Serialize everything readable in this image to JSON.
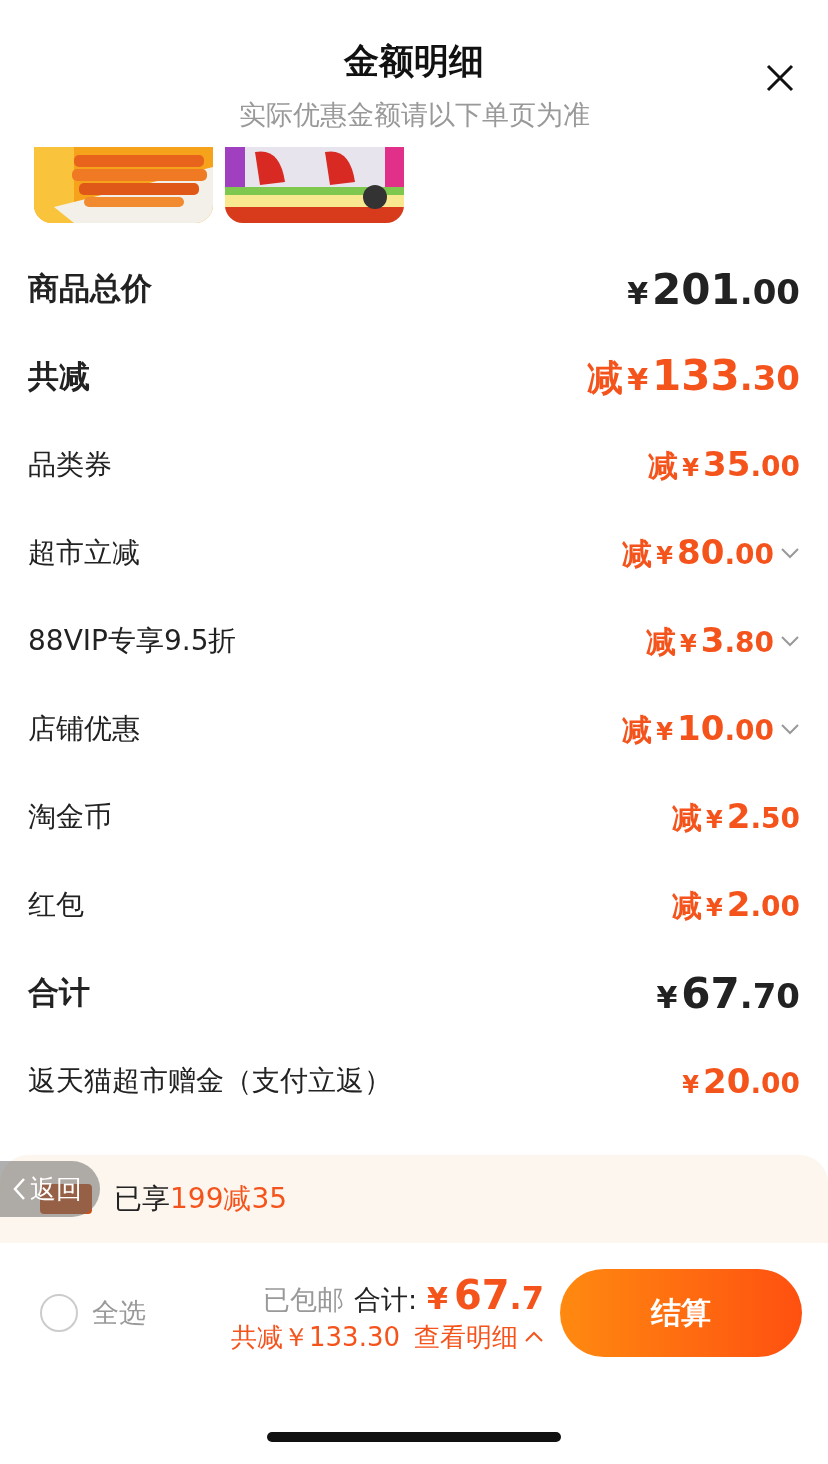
{
  "header": {
    "title": "金额明细",
    "subtitle": "实际优惠金额请以下单页为准",
    "close_button": true
  },
  "rows": [
    {
      "label": "商品总价",
      "kind": "heading",
      "highlight": false,
      "expandable": false,
      "amount": {
        "currency": "¥",
        "integer": "201",
        "decimal": ".00"
      }
    },
    {
      "label": "共减",
      "kind": "heading",
      "highlight": true,
      "expandable": false,
      "amount": {
        "sign": "减",
        "currency": "¥",
        "integer": "133",
        "decimal": ".30"
      }
    },
    {
      "label": "品类券",
      "kind": "line",
      "highlight": true,
      "expandable": false,
      "amount": {
        "sign": "减",
        "currency": "¥",
        "integer": "35",
        "decimal": ".00"
      }
    },
    {
      "label": "超市立减",
      "kind": "line",
      "highlight": true,
      "expandable": true,
      "amount": {
        "sign": "减",
        "currency": "¥",
        "integer": "80",
        "decimal": ".00"
      }
    },
    {
      "label": "88VIP专享9.5折",
      "kind": "line",
      "highlight": true,
      "expandable": true,
      "amount": {
        "sign": "减",
        "currency": "¥",
        "integer": "3",
        "decimal": ".80"
      }
    },
    {
      "label": "店铺优惠",
      "kind": "line",
      "highlight": true,
      "expandable": true,
      "amount": {
        "sign": "减",
        "currency": "¥",
        "integer": "10",
        "decimal": ".00"
      }
    },
    {
      "label": "淘金币",
      "kind": "line",
      "highlight": true,
      "expandable": false,
      "amount": {
        "sign": "减",
        "currency": "¥",
        "integer": "2",
        "decimal": ".50"
      }
    },
    {
      "label": "红包",
      "kind": "line",
      "highlight": true,
      "expandable": false,
      "amount": {
        "sign": "减",
        "currency": "¥",
        "integer": "2",
        "decimal": ".00"
      }
    },
    {
      "label": "合计",
      "kind": "heading",
      "highlight": false,
      "expandable": false,
      "amount": {
        "currency": "¥",
        "integer": "67",
        "decimal": ".70"
      }
    },
    {
      "label": "返天猫超市赠金（支付立返）",
      "kind": "line",
      "highlight": true,
      "expandable": false,
      "amount": {
        "currency": "¥",
        "integer": "20",
        "decimal": ".00"
      }
    }
  ],
  "promo": {
    "text": "已享",
    "highlight": "199减35"
  },
  "back_button": {
    "label": "返回"
  },
  "footer": {
    "select_all": {
      "label": "全选",
      "checked": false
    },
    "shipping": "已包邮",
    "total_label": "合计:",
    "total_currency": "¥",
    "total_integer": "67",
    "total_decimal": ".7",
    "savings": "共减￥133.30",
    "details_link": "查看明细",
    "checkout": "结算"
  }
}
